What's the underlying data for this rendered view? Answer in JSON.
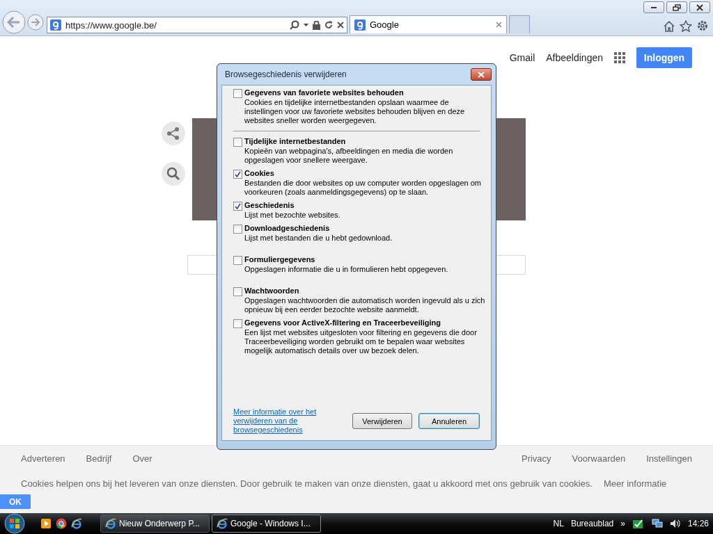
{
  "browser": {
    "address": "https://www.google.be/",
    "tabs": [
      {
        "label": "Google",
        "selected": true
      }
    ]
  },
  "page": {
    "header_links": [
      "Gmail",
      "Afbeeldingen"
    ],
    "signin_button": "Inloggen",
    "footer_left": [
      "Adverteren",
      "Bedrijf",
      "Over"
    ],
    "footer_right": [
      "Privacy",
      "Voorwaarden",
      "Instellingen"
    ],
    "cookie_notice": "Cookies helpen ons bij het leveren van onze diensten. Door gebruik te maken van onze diensten, gaat u akkoord met ons gebruik van cookies.",
    "cookie_link": "Meer informatie",
    "ok_button": "OK"
  },
  "dialog": {
    "title": "Browsegeschiedenis verwijderen",
    "options": [
      {
        "label": "Gegevens van favoriete websites behouden",
        "description": "Cookies en tijdelijke internetbestanden opslaan waarmee de instellingen voor uw favoriete websites behouden blijven en deze websites sneller worden weergegeven.",
        "checked": false
      },
      {
        "label": "Tijdelijke internetbestanden",
        "description": "Kopieën van webpagina's, afbeeldingen en media die worden opgeslagen voor snellere weergave.",
        "checked": false
      },
      {
        "label": "Cookies",
        "description": "Bestanden die door websites op uw computer worden opgeslagen om voorkeuren (zoals aanmeldingsgegevens) op te slaan.",
        "checked": true
      },
      {
        "label": "Geschiedenis",
        "description": "Lijst met bezochte websites.",
        "checked": true
      },
      {
        "label": "Downloadgeschiedenis",
        "description": "Lijst met bestanden die u hebt gedownload.",
        "checked": false
      },
      {
        "label": "Formuliergegevens",
        "description": "Opgeslagen informatie die u in formulieren hebt opgegeven.",
        "checked": false
      },
      {
        "label": "Wachtwoorden",
        "description": "Opgeslagen wachtwoorden die automatisch worden ingevuld als u zich opnieuw bij een eerder bezochte website aanmeldt.",
        "checked": false
      },
      {
        "label": "Gegevens voor ActiveX-filtering en Traceerbeveiliging",
        "description": "Een lijst met websites uitgesloten voor filtering en gegevens die door Traceerbeveiliging worden gebruikt om te bepalen waar websites mogelijk automatisch details over uw bezoek delen.",
        "checked": false
      }
    ],
    "link": "Meer informatie over het verwijderen van de browsegeschiedenis",
    "buttons": [
      {
        "label": "Verwijderen",
        "focused": false
      },
      {
        "label": "Annuleren",
        "focused": true
      }
    ]
  },
  "taskbar": {
    "buttons": [
      {
        "label": "Nieuw Onderwerp P...",
        "selected": false
      },
      {
        "label": "Google - Windows I...",
        "selected": true
      }
    ],
    "language": "NL",
    "desktop": "Bureaublad",
    "more": "»",
    "clock": "14:26"
  }
}
